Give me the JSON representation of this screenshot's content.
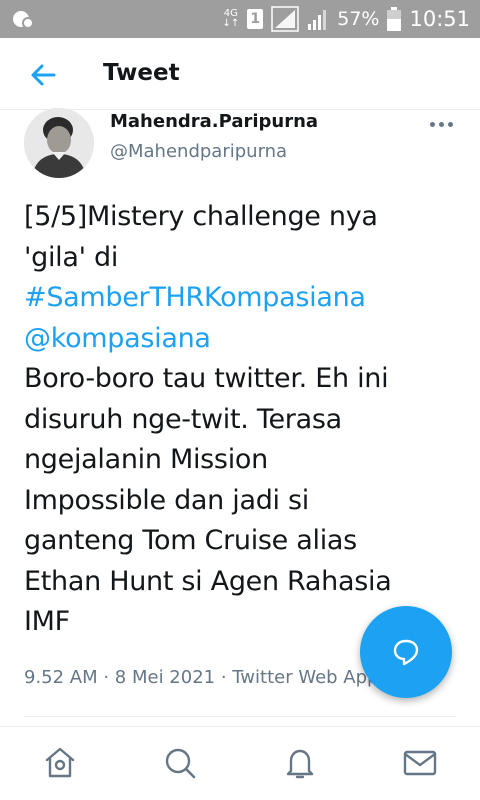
{
  "status_bar": {
    "network_label_top": "4G",
    "network_label_bottom": "↓↑",
    "sim_slot": "1",
    "battery": "57%",
    "time": "10:51"
  },
  "header": {
    "title": "Tweet"
  },
  "tweet": {
    "author_name": "Mahendra.Paripurna",
    "author_handle": "@Mahendparipurna",
    "lines": {
      "l1": "[5/5]Mistery challenge nya",
      "l2": "'gila' di",
      "hashtag": "#SamberTHRKompasiana",
      "mention": "@kompasiana",
      "l5": "Boro-boro tau twitter. Eh ini",
      "l6": "disuruh nge-twit. Terasa",
      "l7": "ngejalanin Mission",
      "l8": "Impossible dan jadi si",
      "l9": "ganteng Tom Cruise alias",
      "l10": "Ethan Hunt si Agen Rahasia",
      "l11": "IMF"
    },
    "meta": "9.52 AM · 8 Mei 2021 · Twitter Web App"
  },
  "colors": {
    "accent": "#1da1f2",
    "text": "#14171a",
    "secondary": "#657786",
    "status_bar": "#9e9e9e"
  },
  "icons": {
    "back": "arrow-left-icon",
    "fab": "reply-bubble-icon",
    "nav": [
      "home-icon",
      "search-icon",
      "bell-icon",
      "mail-icon"
    ]
  }
}
